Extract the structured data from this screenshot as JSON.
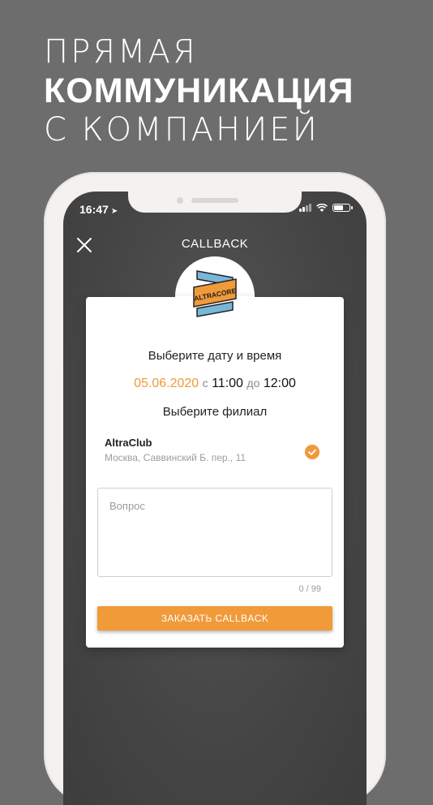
{
  "headline": {
    "line1": "ПРЯМАЯ",
    "line2": "КОММУНИКАЦИЯ",
    "line3": "С КОМПАНИЕЙ"
  },
  "status_bar": {
    "time": "16:47",
    "icons": [
      "location-arrow-icon",
      "signal-icon",
      "wifi-icon",
      "battery-icon"
    ]
  },
  "nav": {
    "title": "CALLBACK",
    "close_icon": "close-icon"
  },
  "logo": {
    "text": "ALTRACORE",
    "colors": {
      "orange": "#f09a3a",
      "blue": "#79b7d8",
      "dark": "#222222"
    }
  },
  "form": {
    "date_time_title": "Выберите дату и время",
    "date": "05.06.2020",
    "from_label": "с",
    "time_from": "11:00",
    "to_label": "до",
    "time_to": "12:00",
    "branch_title": "Выберите филиал",
    "branch": {
      "name": "AltraClub",
      "address": "Москва, Саввинский Б. пер., 11",
      "selected": true
    },
    "question_placeholder": "Вопрос",
    "question_value": "",
    "counter": "0 / 99",
    "submit_label": "ЗАКАЗАТЬ CALLBACK"
  },
  "colors": {
    "accent": "#f09a3a",
    "background": "#6e6d6e",
    "phone_frame": "#f4f1ef"
  }
}
